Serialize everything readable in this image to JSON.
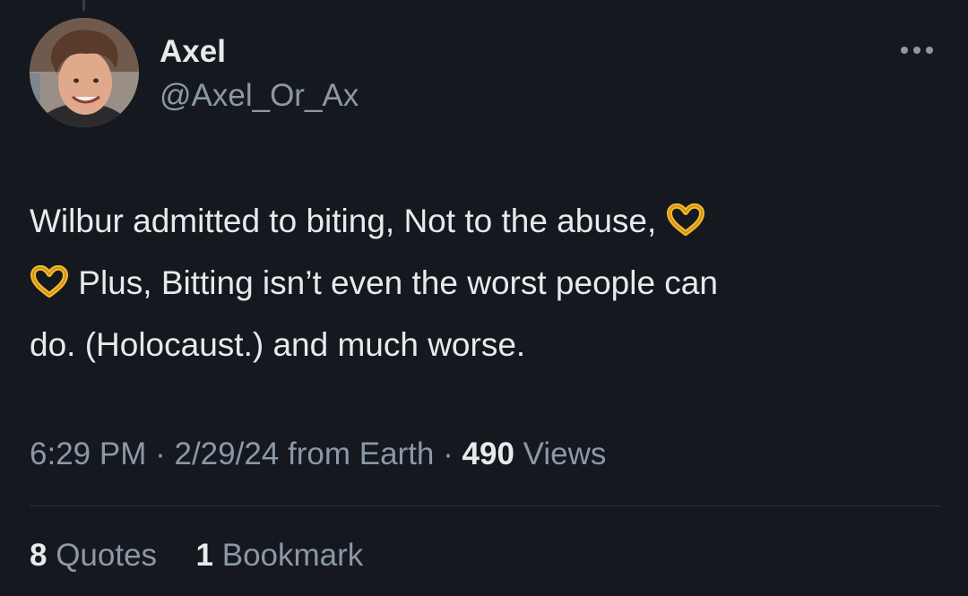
{
  "author": {
    "display_name": "Axel",
    "handle": "@Axel_Or_Ax"
  },
  "tweet": {
    "line1": "Wilbur admitted to biting, Not to the abuse,",
    "line2": "Plus, Bitting isn’t even the worst people can",
    "line3": "do. (Holocaust.) and much worse.",
    "emoji_icon": "heart-hands-emoji"
  },
  "meta": {
    "time": "6:29 PM",
    "separator": "·",
    "date": "2/29/24",
    "source": "from Earth",
    "views_count": "490",
    "views_label": "Views"
  },
  "stats": {
    "quotes_count": "8",
    "quotes_label": "Quotes",
    "bookmarks_count": "1",
    "bookmarks_label": "Bookmark"
  },
  "colors": {
    "background": "#15181f",
    "primary_text": "#e7e9ea",
    "secondary_text": "#8b98a5",
    "divider": "#2f3336"
  }
}
